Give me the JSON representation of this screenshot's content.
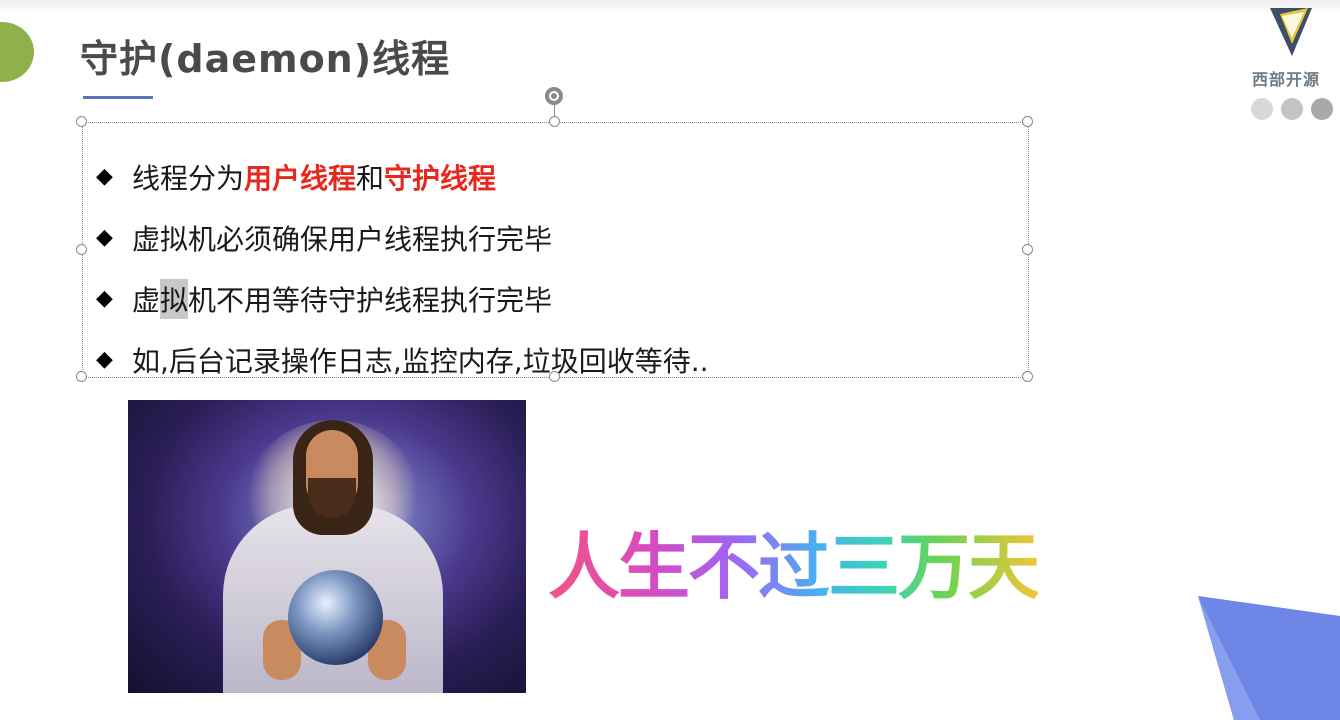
{
  "slide": {
    "title": "守护(daemon)线程",
    "logo_text": "西部开源",
    "bullets": [
      {
        "parts": [
          {
            "text": "线程分为",
            "style": "normal"
          },
          {
            "text": "用户线程",
            "style": "red"
          },
          {
            "text": "和",
            "style": "normal"
          },
          {
            "text": "守护线程",
            "style": "red"
          }
        ]
      },
      {
        "parts": [
          {
            "text": "虚拟机必须确保用户线程执行完毕",
            "style": "normal"
          }
        ]
      },
      {
        "parts": [
          {
            "text": "虚",
            "style": "normal"
          },
          {
            "text": "拟",
            "style": "selected"
          },
          {
            "text": "机不用等待守护线程执行完毕",
            "style": "normal"
          }
        ]
      },
      {
        "parts": [
          {
            "text": "如,后台记录操作日志,监控内存,垃圾回收等待..",
            "style": "normal"
          }
        ]
      }
    ],
    "art_text": "人生不过三万天",
    "colors": {
      "accent_green": "#8fb14b",
      "title_underline": "#5a73b8",
      "emphasis_red": "#e8281d",
      "corner_blue": "#6e86e6"
    }
  }
}
